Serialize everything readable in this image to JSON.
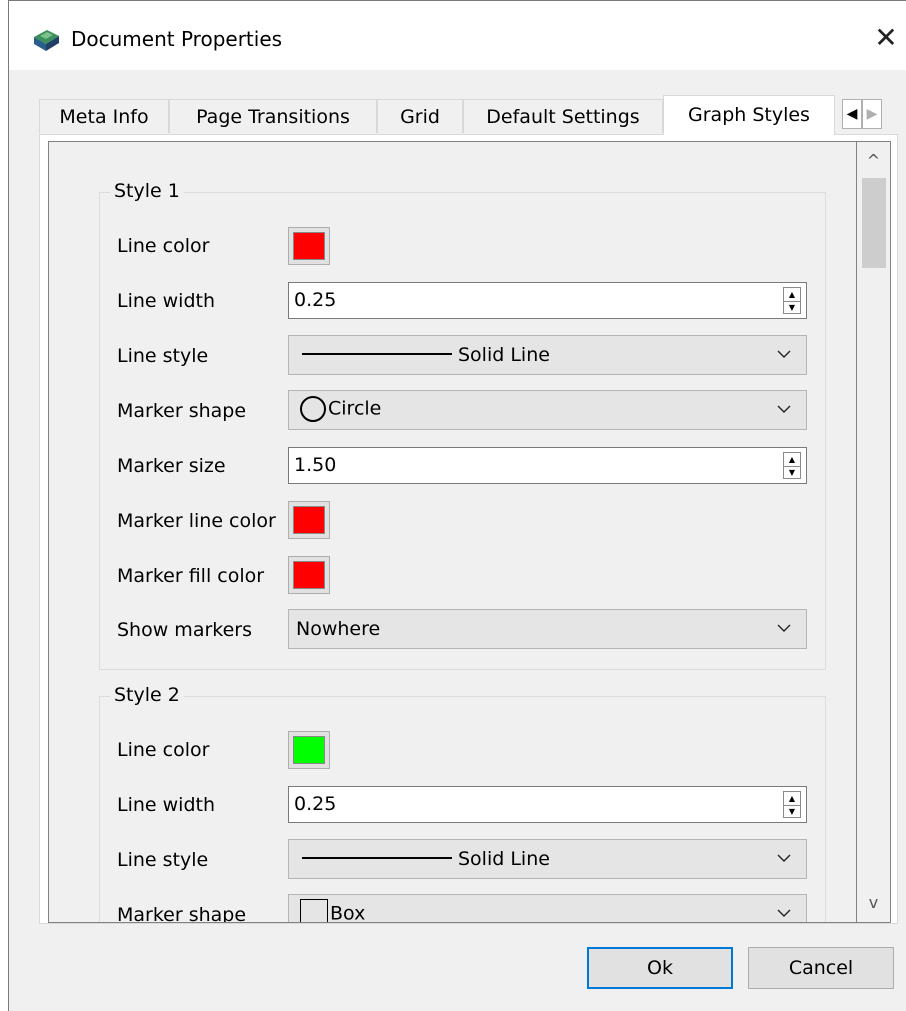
{
  "window": {
    "title": "Document Properties",
    "close_glyph": "✕",
    "icon": "app-document-icon"
  },
  "tabs": [
    {
      "label": "Meta Info",
      "active": false
    },
    {
      "label": "Page Transitions",
      "active": false
    },
    {
      "label": "Grid",
      "active": false
    },
    {
      "label": "Default Settings",
      "active": false
    },
    {
      "label": "Graph Styles",
      "active": true
    }
  ],
  "tab_scroll": {
    "left_glyph": "◀",
    "right_glyph": "▶"
  },
  "scrollbar": {
    "up_glyph": "^",
    "down_glyph": "v"
  },
  "style1": {
    "legend": "Style 1",
    "line_color_label": "Line color",
    "line_color": "#ff0000",
    "line_width_label": "Line width",
    "line_width": "0.25",
    "line_style_label": "Line style",
    "line_style": "Solid Line",
    "marker_shape_label": "Marker shape",
    "marker_shape": "Circle",
    "marker_size_label": "Marker size",
    "marker_size": "1.50",
    "marker_line_color_label": "Marker line color",
    "marker_line_color": "#ff0000",
    "marker_fill_color_label": "Marker fill color",
    "marker_fill_color": "#ff0000",
    "show_markers_label": "Show markers",
    "show_markers": "Nowhere"
  },
  "style2": {
    "legend": "Style 2",
    "line_color_label": "Line color",
    "line_color": "#00ff00",
    "line_width_label": "Line width",
    "line_width": "0.25",
    "line_style_label": "Line style",
    "line_style": "Solid Line",
    "marker_shape_label": "Marker shape",
    "marker_shape": "Box"
  },
  "buttons": {
    "ok": "Ok",
    "cancel": "Cancel"
  },
  "colors": {
    "accent": "#0078d7"
  }
}
